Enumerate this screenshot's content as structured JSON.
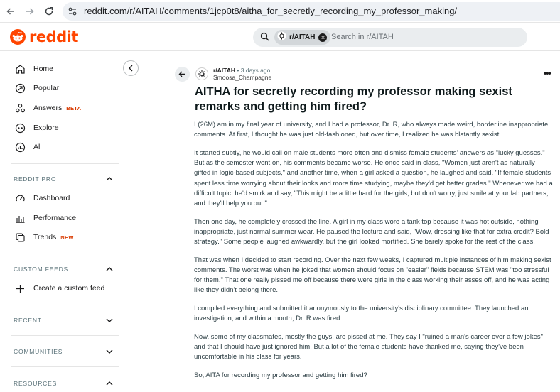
{
  "browser": {
    "url": "reddit.com/r/AITAH/comments/1jcp0t8/aitha_for_secretly_recording_my_professor_making/"
  },
  "header": {
    "logo_text": "reddit",
    "search": {
      "chip_label": "r/AITAH",
      "placeholder": "Search in r/AITAH"
    }
  },
  "sidebar": {
    "items": [
      {
        "label": "Home",
        "icon": "home-icon"
      },
      {
        "label": "Popular",
        "icon": "popular-icon"
      },
      {
        "label": "Answers",
        "icon": "answers-icon",
        "badge": "BETA"
      },
      {
        "label": "Explore",
        "icon": "explore-icon"
      },
      {
        "label": "All",
        "icon": "all-icon"
      }
    ],
    "pro": {
      "heading": "REDDIT PRO",
      "items": [
        {
          "label": "Dashboard",
          "icon": "dashboard-icon"
        },
        {
          "label": "Performance",
          "icon": "performance-icon"
        },
        {
          "label": "Trends",
          "icon": "trends-icon",
          "badge": "NEW"
        }
      ]
    },
    "custom_feeds": {
      "heading": "CUSTOM FEEDS",
      "create_label": "Create a custom feed"
    },
    "recent_heading": "RECENT",
    "communities_heading": "COMMUNITIES",
    "resources_heading": "RESOURCES"
  },
  "post": {
    "subreddit": "r/AITAH",
    "separator": "•",
    "time": "3 days ago",
    "author": "Smoosa_Champagne",
    "title": "AITHA for secretly recording my professor making sexist remarks and getting him fired?",
    "paragraphs": [
      "I (26M) am in my final year of university, and I had a professor, Dr. R, who always made weird, borderline inappropriate comments. At first, I thought he was just old-fashioned, but over time, I realized he was blatantly sexist.",
      "It started subtly, he would call on male students more often and dismiss female students' answers as \"lucky guesses.\" But as the semester went on, his comments became worse. He once said in class, \"Women just aren't as naturally gifted in logic-based subjects,\" and another time, when a girl asked a question, he laughed and said, \"If female students spent less time worrying about their looks and more time studying, maybe they'd get better grades.\" Whenever we had a difficult topic, he'd smirk and say, \"This might be a little hard for the girls, but don't worry, just smile at your lab partners, and they'll help you out.\"",
      "Then one day, he completely crossed the line. A girl in my class wore a tank top because it was hot outside, nothing inappropriate, just normal summer wear. He paused the lecture and said, \"Wow, dressing like that for extra credit? Bold strategy.\" Some people laughed awkwardly, but the girl looked mortified. She barely spoke for the rest of the class.",
      "That was when I decided to start recording. Over the next few weeks, I captured multiple instances of him making sexist comments. The worst was when he joked that women should focus on \"easier\" fields because STEM was \"too stressful for them.\" That one really pissed me off because there were girls in the class working their asses off, and he was acting like they didn't belong there.",
      "I compiled everything and submitted it anonymously to the university's disciplinary committee. They launched an investigation, and within a month, Dr. R was fired.",
      "Now, some of my classmates, mostly the guys, are pissed at me. They say I \"ruined a man's career over a few jokes\" and that I should have just ignored him. But a lot of the female students have thanked me, saying they've been uncomfortable in his class for years.",
      "So, AITA for recording my professor and getting him fired?"
    ]
  },
  "colors": {
    "brand": "#ff4500",
    "badge": "#d93a00",
    "sidebar_heading": "#576f76"
  }
}
